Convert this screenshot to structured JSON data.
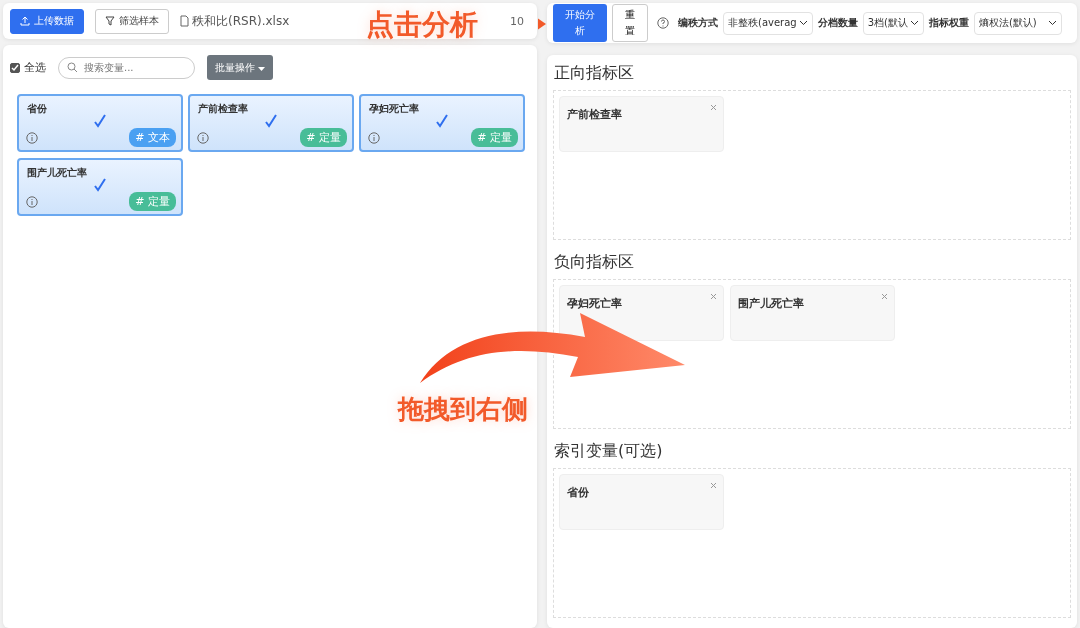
{
  "toolbar_left": {
    "buttons": [
      {
        "label": "上传数据",
        "kind": "upload"
      },
      {
        "label": "筛选样本",
        "kind": "filter"
      }
    ],
    "file_name": "秩和比(RSR).xlsx",
    "sample_count": "10"
  },
  "variable_panel": {
    "select_all": {
      "label": "全选",
      "checked": true
    },
    "search": {
      "placeholder": "搜索变量..."
    },
    "batch_button": "批量操作",
    "variables": [
      {
        "name": "省份",
        "selected": true,
        "type": "# 文本",
        "kind": "text"
      },
      {
        "name": "产前检查率",
        "selected": true,
        "type": "# 定量",
        "kind": "quantity"
      },
      {
        "name": "孕妇死亡率",
        "selected": true,
        "type": "# 定量",
        "kind": "quantity"
      },
      {
        "name": "围产儿死亡率",
        "selected": true,
        "type": "# 定量",
        "kind": "quantity"
      }
    ]
  },
  "toolbar_right": {
    "start_button": "开始分析",
    "reset_button": "重置",
    "settings": [
      {
        "label": "编秩方式",
        "value": "非整秩(averag"
      },
      {
        "label": "分档数量",
        "value": "3档(默认"
      },
      {
        "label": "指标权重",
        "value": "熵权法(默认)"
      }
    ]
  },
  "zones": [
    {
      "title": "正向指标区",
      "items": [
        "产前检查率"
      ]
    },
    {
      "title": "负向指标区",
      "items": [
        "孕妇死亡率",
        "围产儿死亡率"
      ]
    },
    {
      "title": "索引变量(可选)",
      "items": [
        "省份"
      ]
    }
  ],
  "annotations": [
    {
      "text": "点击分析",
      "kind": "click"
    },
    {
      "text": "拖拽到右侧",
      "kind": "drag"
    }
  ]
}
